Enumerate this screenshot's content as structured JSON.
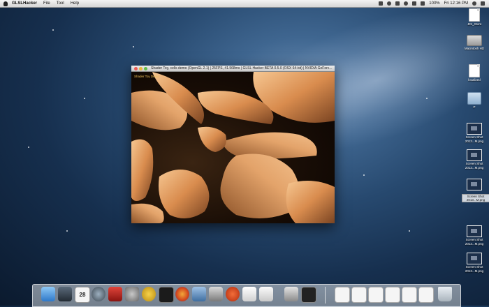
{
  "menubar": {
    "app_name": "GLSLHacker",
    "items": [
      "File",
      "Tool",
      "Help"
    ],
    "battery": "100%",
    "clock": "Fri 12:16 PM"
  },
  "window": {
    "title": "Shader Toy, cells demo (OpenGL 2.1) | 25FPS, 41.568ms | GLSL Hacker BETA 0.5.0 (OSX 64-bit) | NVIDIA GeForc...",
    "overlay": "Shader Toy Demo"
  },
  "desktop_icons": [
    {
      "name": ".DS_Store",
      "type": "doc"
    },
    {
      "name": "Macintosh HD",
      "type": "hd"
    },
    {
      "name": "localized",
      "type": "doc"
    },
    {
      "name": "P",
      "type": "folder"
    },
    {
      "name": "Screen Shot 2013...M.png",
      "type": "shot"
    },
    {
      "name": "Screen Shot 2013...M.png",
      "type": "shot"
    },
    {
      "name": "Screen Shot 2013...M.png",
      "type": "shot"
    },
    {
      "name": "Screen Shot 2013...M.png",
      "type": "shot"
    },
    {
      "name": "Screen Shot 2013...M.png",
      "type": "shot"
    }
  ],
  "tooltip": "Screen Shot 2013...M.png",
  "dock": {
    "calendar_day": "28",
    "apps": [
      "finder",
      "dashboard",
      "calendar",
      "camera",
      "photo-booth",
      "system-preferences",
      "glsl-hacker",
      "terminal",
      "firefox",
      "xcode",
      "preview",
      "fruit",
      "textedit",
      "pages"
    ],
    "doc_items": 8
  },
  "colors": {
    "menubar": "#e4e4e4",
    "desktop": "#1f3e63",
    "accent": "#f0c25a"
  }
}
